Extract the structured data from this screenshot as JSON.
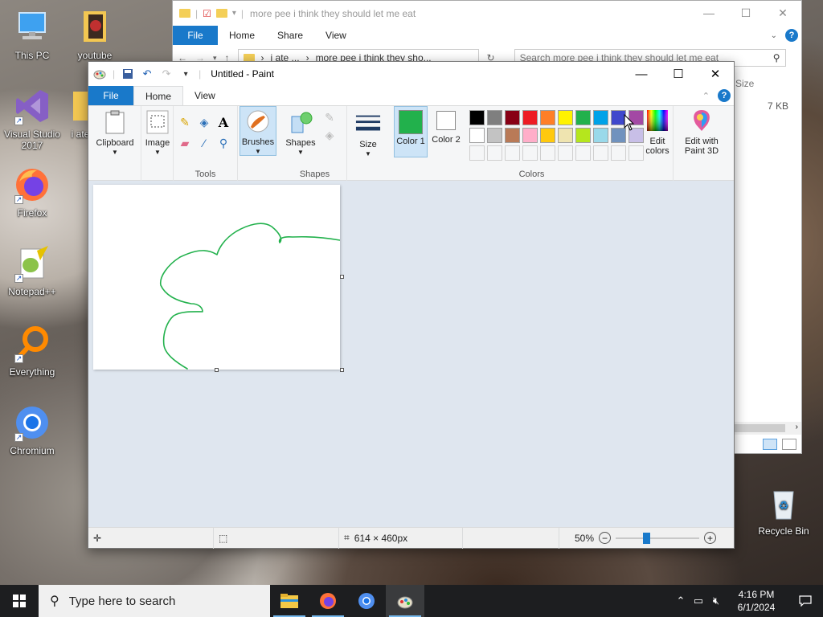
{
  "desktop": {
    "icons": [
      {
        "label": "This PC"
      },
      {
        "label": "youtube"
      },
      {
        "label": "Visual Studio 2017"
      },
      {
        "label": "i ate"
      },
      {
        "label": "Firefox"
      },
      {
        "label": "Notepad++"
      },
      {
        "label": "Everything"
      },
      {
        "label": "Chromium"
      },
      {
        "label": "Recycle Bin"
      }
    ]
  },
  "explorer": {
    "title": "more pee i think they should let me eat",
    "tabs": [
      "File",
      "Home",
      "Share",
      "View"
    ],
    "path": [
      "i ate ...",
      "more pee i think they sho..."
    ],
    "search_placeholder": "Search more pee i think they should let me eat",
    "column_size": "Size",
    "file_size": "7 KB",
    "help": "?"
  },
  "paint": {
    "title": "Untitled - Paint",
    "tabs": {
      "file": "File",
      "home": "Home",
      "view": "View"
    },
    "groups": {
      "clipboard": "Clipboard",
      "image": "Image",
      "tools": "Tools",
      "brushes": "Brushes",
      "shapes_btn": "Shapes",
      "shapes_group": "Shapes",
      "size": "Size",
      "color1": "Color 1",
      "color2": "Color 2",
      "colors_group": "Colors",
      "edit_colors": "Edit colors",
      "paint3d": "Edit with Paint 3D"
    },
    "color1_value": "#22b14c",
    "color2_value": "#ffffff",
    "palette_row1": [
      "#000000",
      "#7f7f7f",
      "#880015",
      "#ed1c24",
      "#ff7f27",
      "#fff200",
      "#22b14c",
      "#00a2e8",
      "#3f48cc",
      "#a349a4"
    ],
    "palette_row2": [
      "#ffffff",
      "#c3c3c3",
      "#b97a57",
      "#ffaec9",
      "#ffc90e",
      "#efe4b0",
      "#b5e61d",
      "#99d9ea",
      "#7092be",
      "#c8bfe7"
    ],
    "status": {
      "dimensions": "614 × 460px",
      "zoom": "50%"
    }
  },
  "taskbar": {
    "search_placeholder": "Type here to search",
    "time": "4:16 PM",
    "date": "6/1/2024"
  }
}
